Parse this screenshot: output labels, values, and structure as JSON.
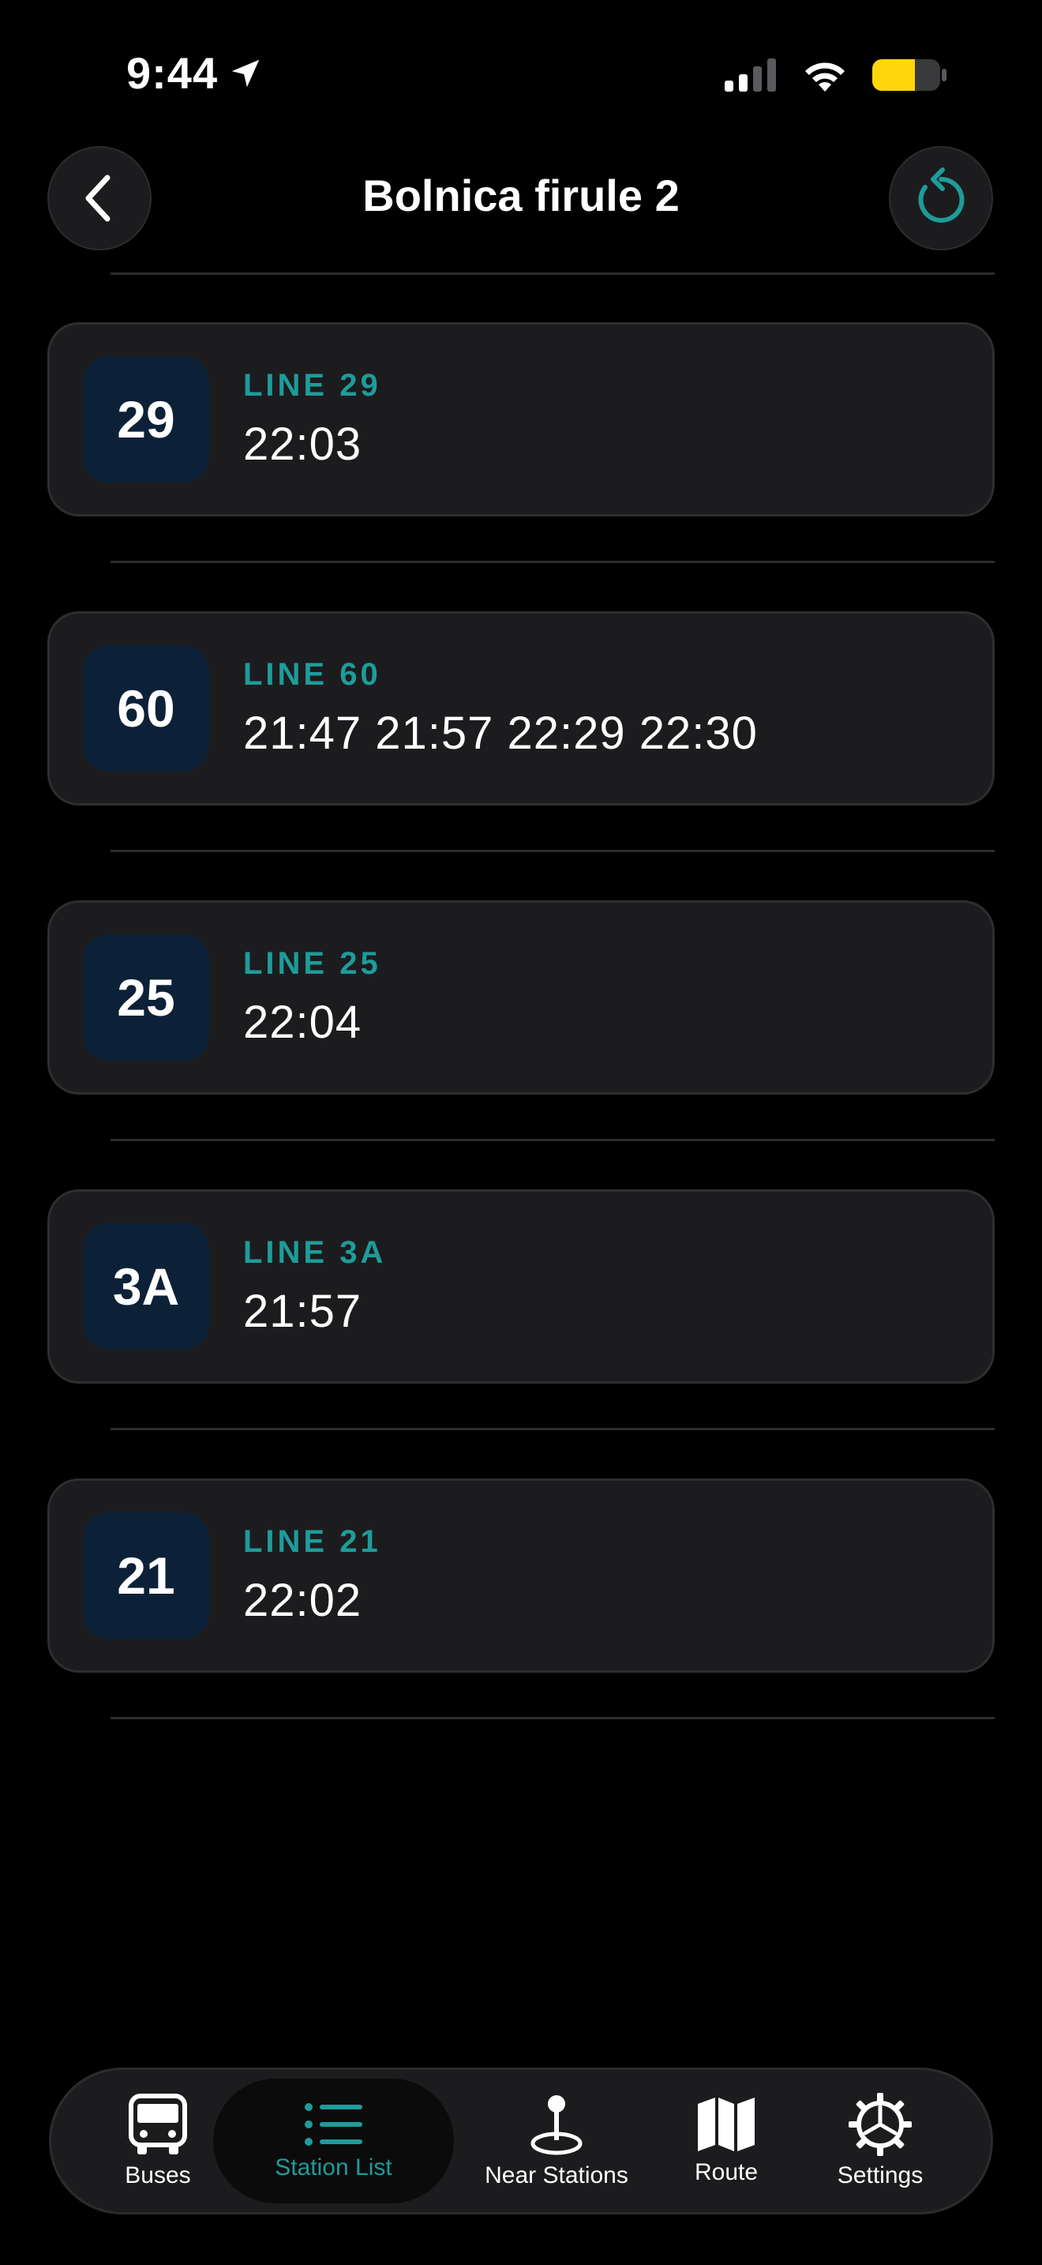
{
  "status_bar": {
    "time": "9:44"
  },
  "header": {
    "title": "Bolnica firule 2"
  },
  "lines": [
    {
      "badge": "29",
      "label": "LINE 29",
      "times": "22:03"
    },
    {
      "badge": "60",
      "label": "LINE 60",
      "times": "21:47 21:57 22:29 22:30"
    },
    {
      "badge": "25",
      "label": "LINE 25",
      "times": "22:04"
    },
    {
      "badge": "3A",
      "label": "LINE 3A",
      "times": "21:57"
    },
    {
      "badge": "21",
      "label": "LINE 21",
      "times": "22:02"
    }
  ],
  "tab_bar": {
    "tabs": [
      {
        "label": "Buses",
        "icon": "bus-icon",
        "active": false
      },
      {
        "label": "Station List",
        "icon": "list-icon",
        "active": true
      },
      {
        "label": "Near Stations",
        "icon": "location-pin-icon",
        "active": false
      },
      {
        "label": "Route",
        "icon": "map-icon",
        "active": false
      },
      {
        "label": "Settings",
        "icon": "gear-icon",
        "active": false
      }
    ]
  },
  "colors": {
    "accent": "#1e9c9a",
    "card_background": "#1c1c1e",
    "badge_background": "#0c2137",
    "battery": "#ffd60a"
  }
}
